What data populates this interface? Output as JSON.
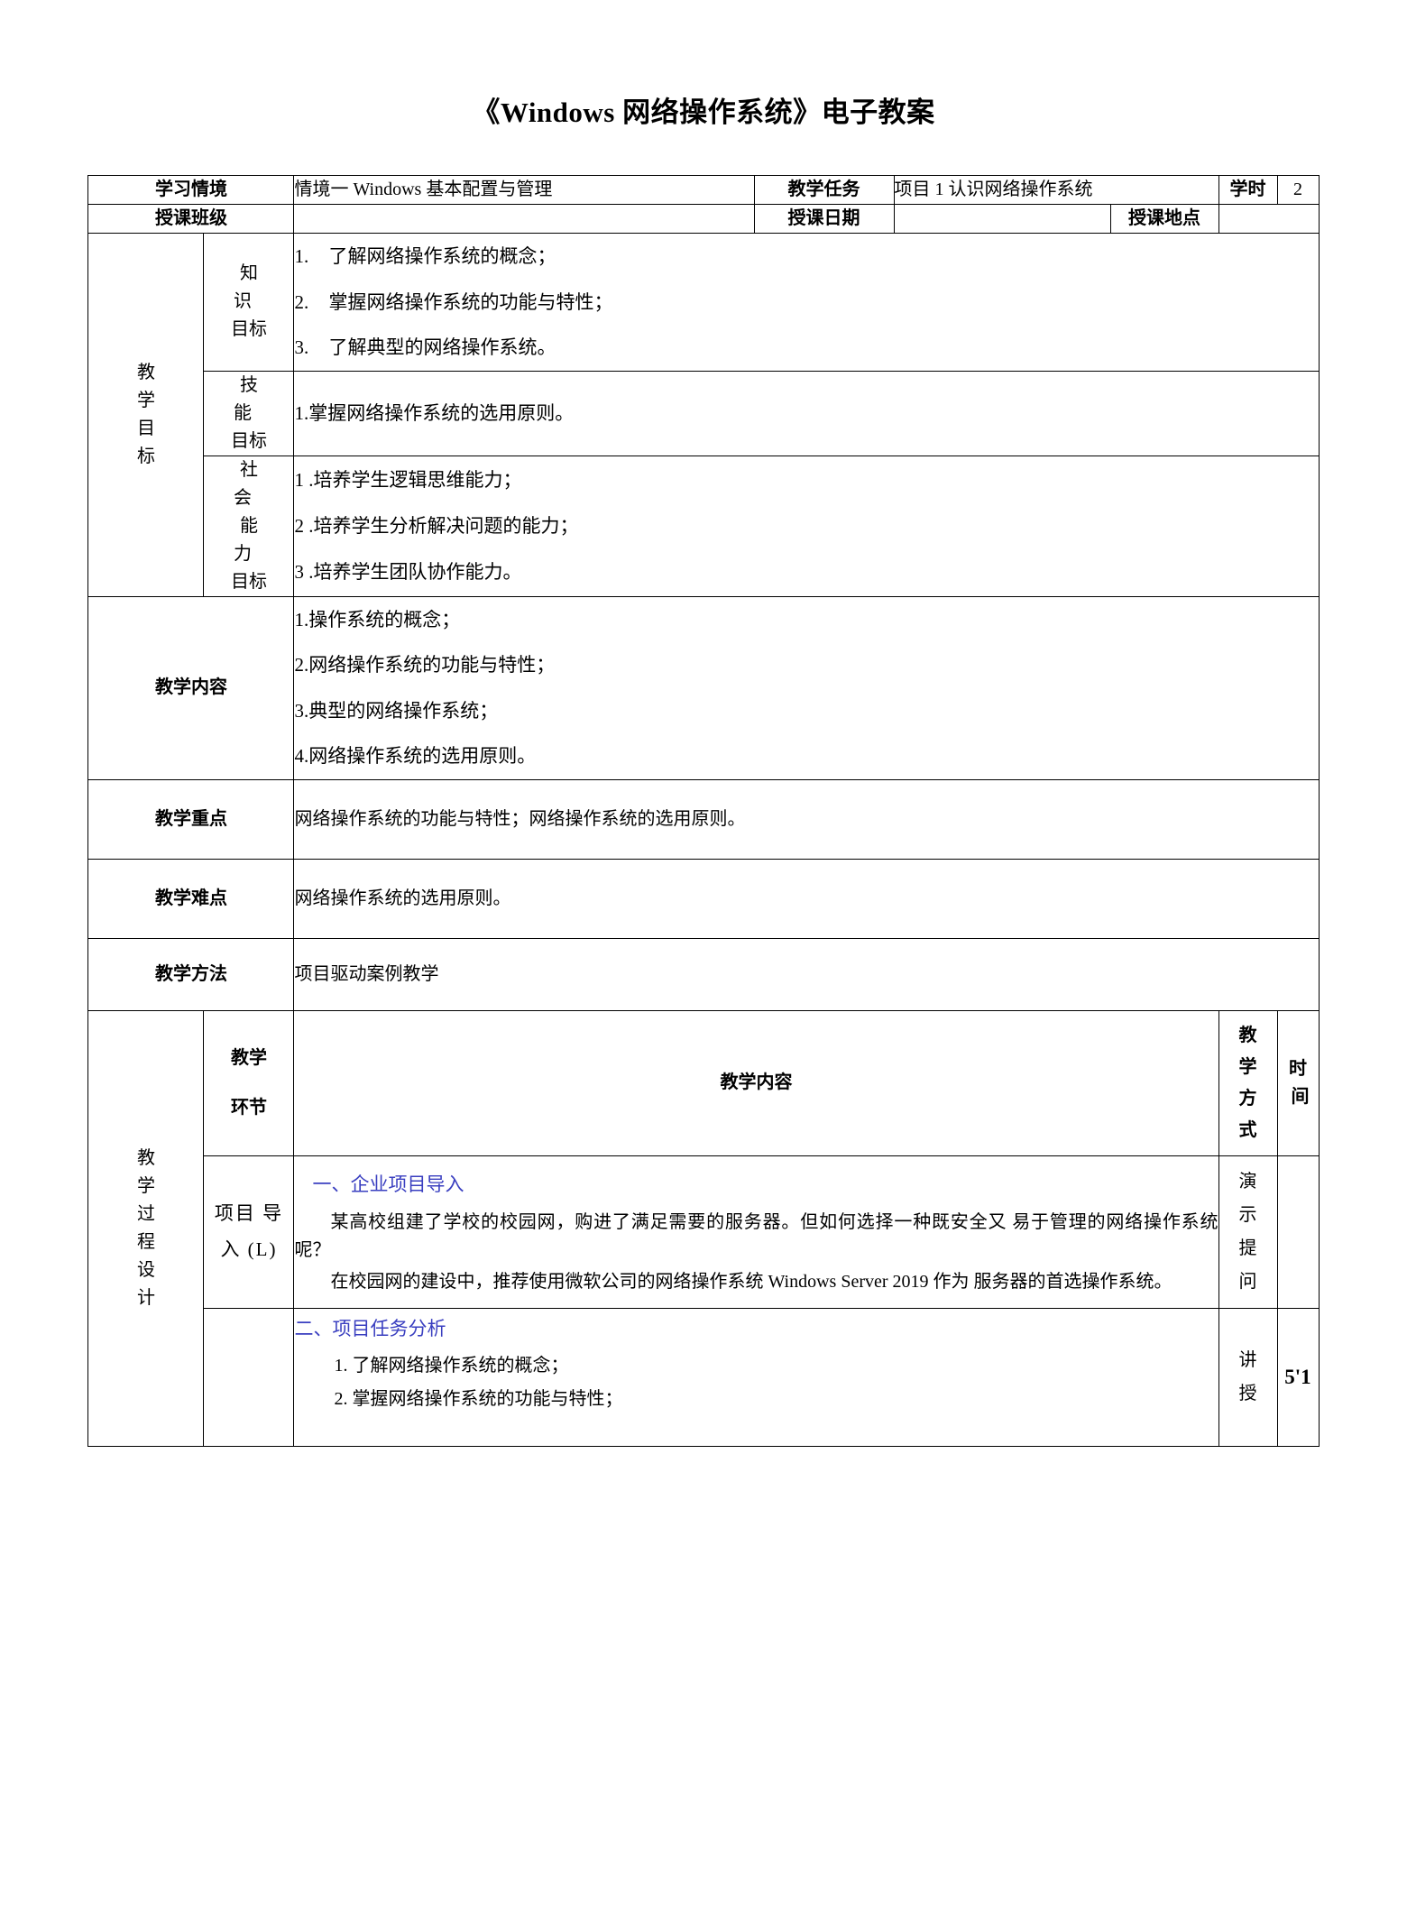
{
  "document": {
    "title": "《Windows 网络操作系统》电子教案"
  },
  "header": {
    "situation_label": "学习情境",
    "situation_value": "情境一  Windows 基本配置与管理",
    "task_label": "教学任务",
    "task_value": "项目 1 认识网络操作系统",
    "hours_label": "学时",
    "hours_value": "2",
    "class_label": "授课班级",
    "class_value": "",
    "date_label": "授课日期",
    "date_value": "",
    "place_label": "授课地点",
    "place_value": ""
  },
  "objectives": {
    "group_label": [
      "教",
      "学",
      "目",
      "标"
    ],
    "knowledge": {
      "label_line1": "知 识",
      "label_line2": "目标",
      "items": [
        {
          "n": "1.",
          "text": "了解网络操作系统的概念；"
        },
        {
          "n": "2.",
          "text": "掌握网络操作系统的功能与特性；"
        },
        {
          "n": "3.",
          "text": "了解典型的网络操作系统。"
        }
      ]
    },
    "skill": {
      "label_line1": "技 能",
      "label_line2": "目标",
      "items": [
        {
          "text": "1.掌握网络操作系统的选用原则。"
        }
      ]
    },
    "social": {
      "label_line1": "社 会",
      "label_line2": "能 力",
      "label_line3": "目标",
      "items": [
        {
          "text": "1 .培养学生逻辑思维能力；"
        },
        {
          "text": "2 .培养学生分析解决问题的能力；"
        },
        {
          "text": "3 .培养学生团队协作能力。"
        }
      ]
    }
  },
  "teaching_content": {
    "label": "教学内容",
    "items": [
      {
        "text": "1.操作系统的概念；"
      },
      {
        "text": "2.网络操作系统的功能与特性；"
      },
      {
        "text": "3.典型的网络操作系统；"
      },
      {
        "text": "4.网络操作系统的选用原则。"
      }
    ]
  },
  "key_points": {
    "label": "教学重点",
    "value": "网络操作系统的功能与特性；网络操作系统的选用原则。"
  },
  "difficulties": {
    "label": "教学难点",
    "value": "网络操作系统的选用原则。"
  },
  "methods": {
    "label": "教学方法",
    "value": "项目驱动案例教学"
  },
  "process": {
    "group_label": [
      "教",
      "学",
      "过",
      "程",
      "设",
      "计"
    ],
    "columns": {
      "stage": [
        "教学",
        "环节"
      ],
      "content": "教学内容",
      "mode": [
        "教",
        "学",
        "方",
        "式"
      ],
      "time": [
        "时",
        "间"
      ]
    },
    "rows": [
      {
        "stage_line1": "项目 导",
        "stage_line2": "入 (L)",
        "section_title": "一、企业项目导入",
        "paragraphs": [
          "某高校组建了学校的校园网，购进了满足需要的服务器。但如何选择一种既安全又 易于管理的网络操作系统呢？",
          "在校园网的建设中，推荐使用微软公司的网络操作系统 Windows Server 2019 作为 服务器的首选操作系统。"
        ],
        "mode": [
          "演",
          "示",
          "提",
          "问"
        ],
        "time": ""
      },
      {
        "stage_line1": "",
        "stage_line2": "",
        "section_title": "二、项目任务分析",
        "items": [
          "1. 了解网络操作系统的概念；",
          "2. 掌握网络操作系统的功能与特性；"
        ],
        "mode": [
          "讲",
          "授"
        ],
        "time": "5'1"
      }
    ]
  },
  "colors": {
    "section_heading": "#3a3fc0",
    "border": "#000000",
    "text": "#000000"
  }
}
